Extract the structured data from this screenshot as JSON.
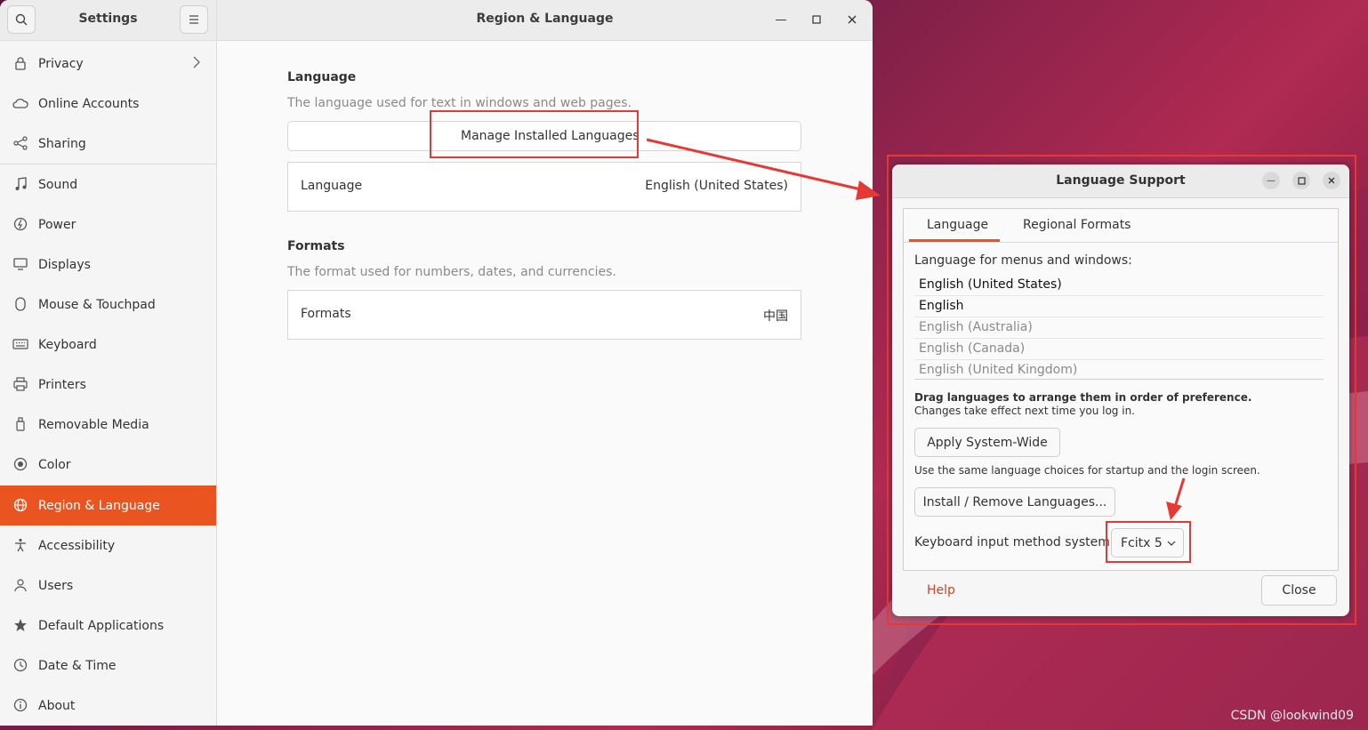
{
  "settings": {
    "sidebar_title": "Settings",
    "window_title": "Region & Language",
    "nav": [
      {
        "label": "Privacy",
        "icon": "lock-icon",
        "has_chevron": true
      },
      {
        "label": "Online Accounts",
        "icon": "cloud-icon"
      },
      {
        "label": "Sharing",
        "icon": "share-icon"
      },
      {
        "label": "Sound",
        "icon": "music-note-icon"
      },
      {
        "label": "Power",
        "icon": "power-icon"
      },
      {
        "label": "Displays",
        "icon": "display-icon"
      },
      {
        "label": "Mouse & Touchpad",
        "icon": "mouse-icon"
      },
      {
        "label": "Keyboard",
        "icon": "keyboard-icon"
      },
      {
        "label": "Printers",
        "icon": "printer-icon"
      },
      {
        "label": "Removable Media",
        "icon": "usb-drive-icon"
      },
      {
        "label": "Color",
        "icon": "color-palette-icon"
      },
      {
        "label": "Region & Language",
        "icon": "globe-icon",
        "active": true
      },
      {
        "label": "Accessibility",
        "icon": "accessibility-icon"
      },
      {
        "label": "Users",
        "icon": "users-icon"
      },
      {
        "label": "Default Applications",
        "icon": "star-icon"
      },
      {
        "label": "Date & Time",
        "icon": "clock-icon"
      },
      {
        "label": "About",
        "icon": "info-icon"
      }
    ],
    "language_section": {
      "title": "Language",
      "description": "The language used for text in windows and web pages.",
      "manage_button": "Manage Installed Languages",
      "row_label": "Language",
      "row_value": "English (United States)"
    },
    "formats_section": {
      "title": "Formats",
      "description": "The format used for numbers, dates, and currencies.",
      "row_label": "Formats",
      "row_value": "中国"
    }
  },
  "dialog": {
    "title": "Language Support",
    "tabs": [
      "Language",
      "Regional Formats"
    ],
    "menus_label": "Language for menus and windows:",
    "languages": [
      {
        "label": "English (United States)",
        "enabled": true
      },
      {
        "label": "English",
        "enabled": true
      },
      {
        "label": "English (Australia)",
        "enabled": false
      },
      {
        "label": "English (Canada)",
        "enabled": false
      },
      {
        "label": "English (United Kingdom)",
        "enabled": false
      }
    ],
    "drag_hint": "Drag languages to arrange them in order of preference.",
    "changes_hint": "Changes take effect next time you log in.",
    "apply_button": "Apply System-Wide",
    "apply_hint": "Use the same language choices for startup and the login screen.",
    "install_button": "Install / Remove Languages...",
    "input_method_label": "Keyboard input method system:",
    "input_method_value": "Fcitx 5",
    "help_label": "Help",
    "close_button": "Close"
  },
  "watermark": "CSDN @lookwind09",
  "colors": {
    "accent": "#e95420",
    "annotation": "#e53935"
  }
}
